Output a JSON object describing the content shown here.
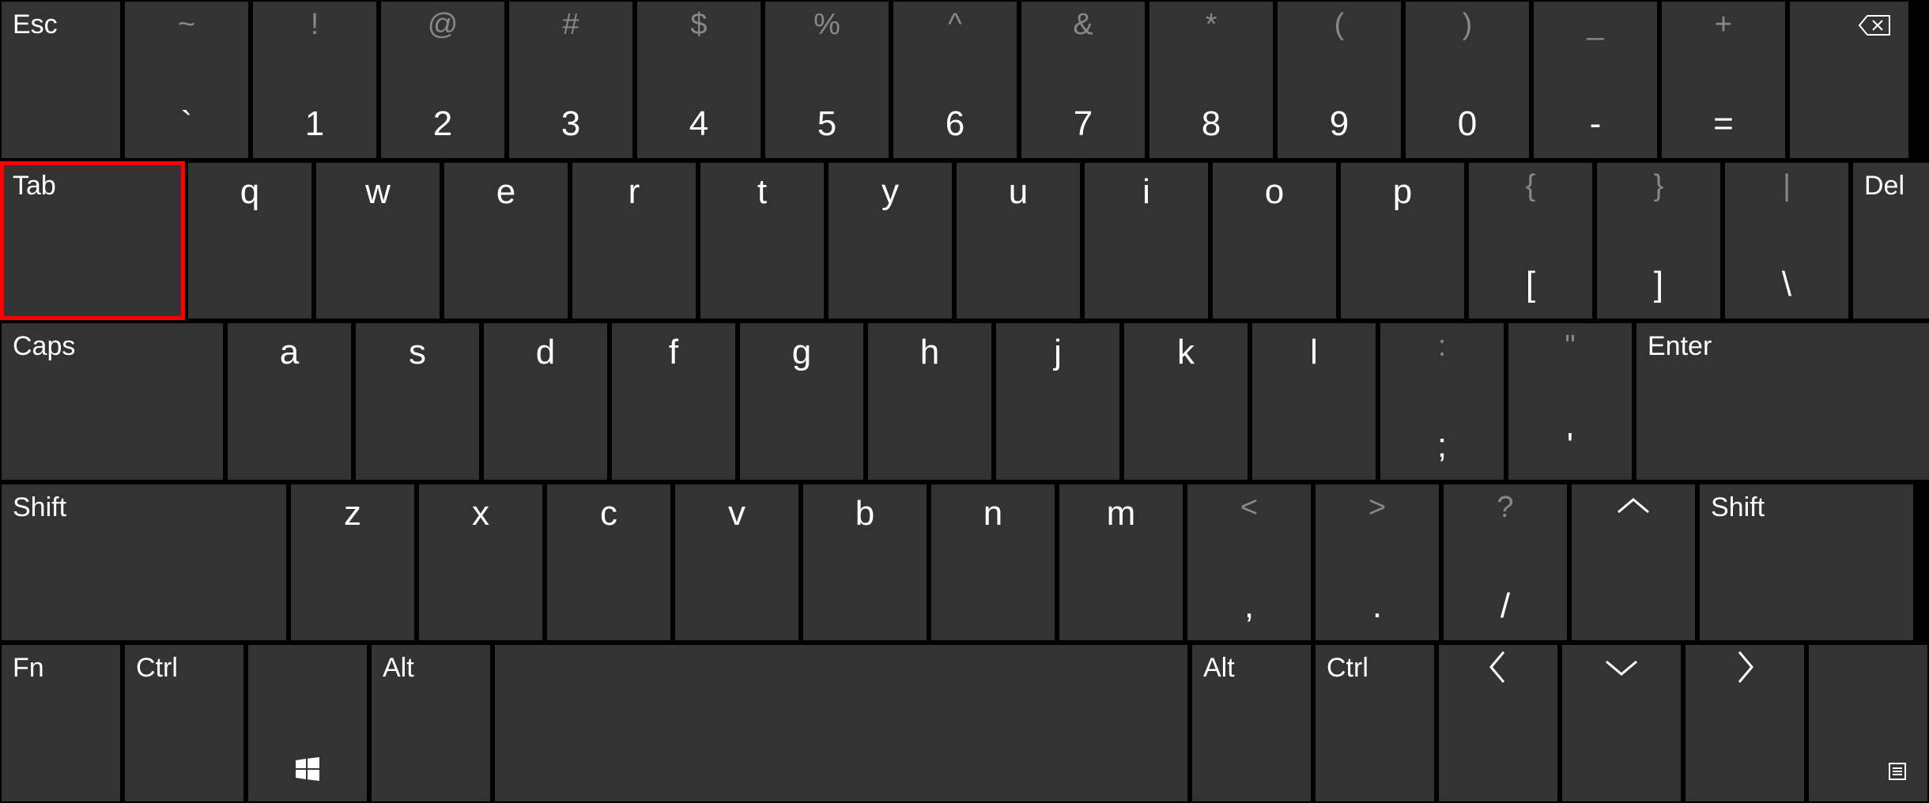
{
  "row1": {
    "esc": "Esc",
    "keys": [
      {
        "shift": "~",
        "main": "`"
      },
      {
        "shift": "!",
        "main": "1"
      },
      {
        "shift": "@",
        "main": "2"
      },
      {
        "shift": "#",
        "main": "3"
      },
      {
        "shift": "$",
        "main": "4"
      },
      {
        "shift": "%",
        "main": "5"
      },
      {
        "shift": "^",
        "main": "6"
      },
      {
        "shift": "&",
        "main": "7"
      },
      {
        "shift": "*",
        "main": "8"
      },
      {
        "shift": "(",
        "main": "9"
      },
      {
        "shift": ")",
        "main": "0"
      },
      {
        "shift": "_",
        "main": "-"
      },
      {
        "shift": "+",
        "main": "="
      }
    ],
    "backspace_icon": "backspace"
  },
  "row2": {
    "tab": "Tab",
    "keys": [
      {
        "main": "q"
      },
      {
        "main": "w"
      },
      {
        "main": "e"
      },
      {
        "main": "r"
      },
      {
        "main": "t"
      },
      {
        "main": "y"
      },
      {
        "main": "u"
      },
      {
        "main": "i"
      },
      {
        "main": "o"
      },
      {
        "main": "p"
      },
      {
        "shift": "{",
        "main": "["
      },
      {
        "shift": "}",
        "main": "]"
      },
      {
        "shift": "|",
        "main": "\\"
      }
    ],
    "del": "Del"
  },
  "row3": {
    "caps": "Caps",
    "keys": [
      {
        "main": "a"
      },
      {
        "main": "s"
      },
      {
        "main": "d"
      },
      {
        "main": "f"
      },
      {
        "main": "g"
      },
      {
        "main": "h"
      },
      {
        "main": "j"
      },
      {
        "main": "k"
      },
      {
        "main": "l"
      },
      {
        "shift": ":",
        "main": ";"
      },
      {
        "shift": "\"",
        "main": "'"
      }
    ],
    "enter": "Enter"
  },
  "row4": {
    "lshift": "Shift",
    "keys": [
      {
        "main": "z"
      },
      {
        "main": "x"
      },
      {
        "main": "c"
      },
      {
        "main": "v"
      },
      {
        "main": "b"
      },
      {
        "main": "n"
      },
      {
        "main": "m"
      },
      {
        "shift": "<",
        "main": ","
      },
      {
        "shift": ">",
        "main": "."
      },
      {
        "shift": "?",
        "main": "/"
      }
    ],
    "up_icon": "up",
    "rshift": "Shift"
  },
  "row5": {
    "fn": "Fn",
    "lctrl": "Ctrl",
    "win_icon": "windows",
    "lalt": "Alt",
    "space": "",
    "ralt": "Alt",
    "rctrl": "Ctrl",
    "left_icon": "left",
    "down_icon": "down",
    "right_icon": "right",
    "menu_icon": "menu"
  },
  "highlighted_key": "tab"
}
